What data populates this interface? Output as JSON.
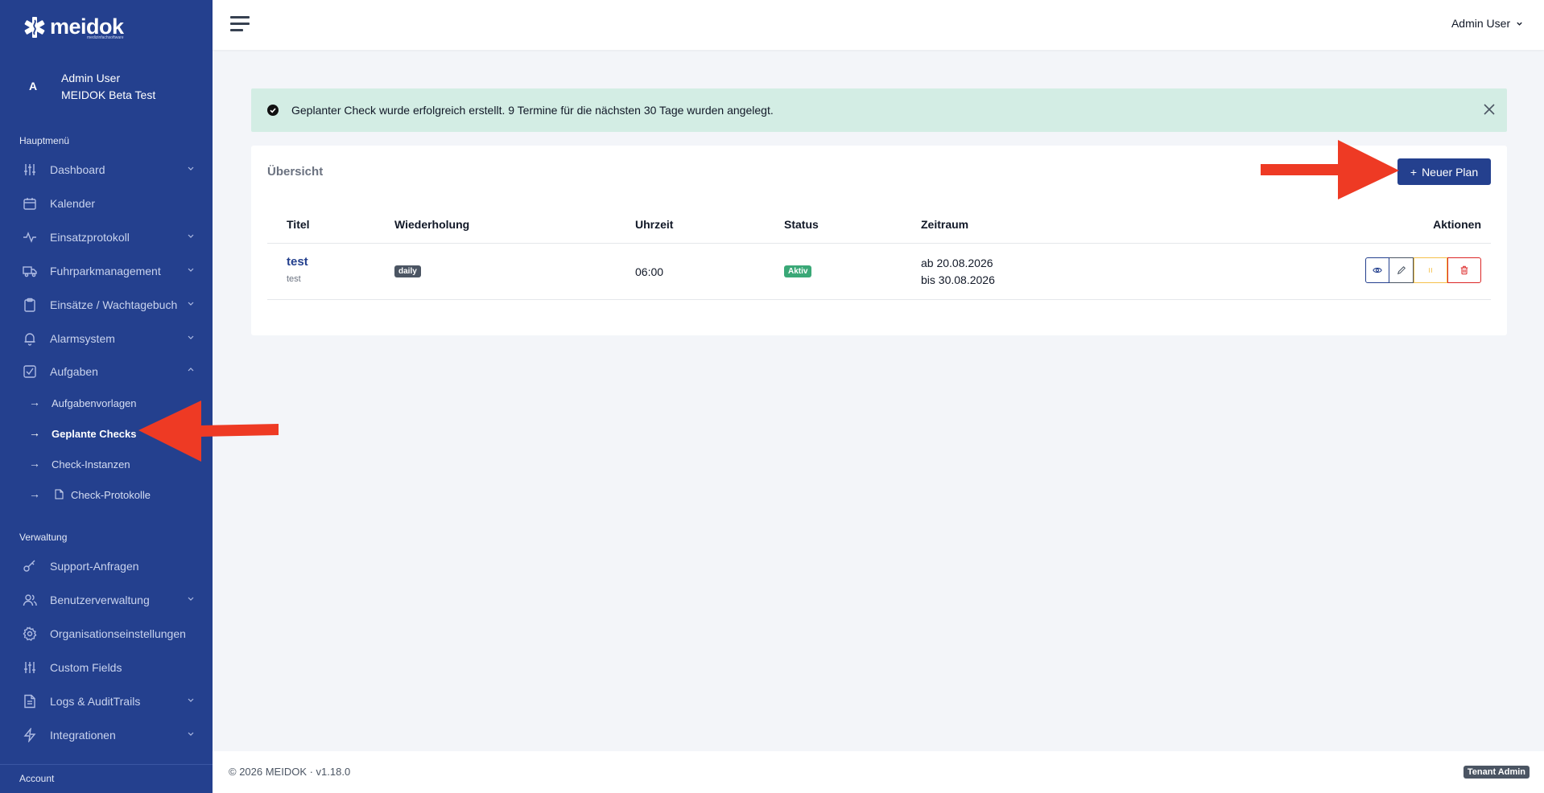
{
  "app": {
    "logo_text": "meidok",
    "logo_sub": "medizinfachsoftware"
  },
  "sidebar": {
    "user": {
      "initial": "A",
      "name": "Admin User",
      "org": "MEIDOK Beta Test"
    },
    "section_main": "Hauptmenü",
    "main_items": [
      {
        "label": "Dashboard",
        "icon": "sliders-icon"
      },
      {
        "label": "Kalender",
        "icon": "calendar-icon"
      },
      {
        "label": "Einsatzprotokoll",
        "icon": "activity-icon"
      },
      {
        "label": "Fuhrparkmanagement",
        "icon": "truck-icon"
      },
      {
        "label": "Einsätze / Wachtagebuch",
        "icon": "clipboard-icon"
      },
      {
        "label": "Alarmsystem",
        "icon": "bell-icon"
      },
      {
        "label": "Aufgaben",
        "icon": "checkbox-icon"
      }
    ],
    "sub_items": [
      {
        "label": "Aufgabenvorlagen"
      },
      {
        "label": "Geplante Checks"
      },
      {
        "label": "Check-Instanzen"
      },
      {
        "label": "Check-Protokolle"
      }
    ],
    "section_admin": "Verwaltung",
    "admin_items": [
      {
        "label": "Support-Anfragen",
        "icon": "key-icon"
      },
      {
        "label": "Benutzerverwaltung",
        "icon": "users-icon"
      },
      {
        "label": "Organisationseinstellungen",
        "icon": "gear-icon"
      },
      {
        "label": "Custom Fields",
        "icon": "sliders-icon"
      },
      {
        "label": "Logs & AuditTrails",
        "icon": "file-icon"
      },
      {
        "label": "Integrationen",
        "icon": "bolt-icon"
      }
    ],
    "footer_label": "Account"
  },
  "topbar": {
    "user": "Admin User"
  },
  "alert": {
    "message": "Geplanter Check wurde erfolgreich erstellt. 9 Termine für die nächsten 30 Tage wurden angelegt."
  },
  "card": {
    "title": "Übersicht",
    "new_button": "Neuer Plan",
    "columns": [
      "Titel",
      "Wiederholung",
      "Uhrzeit",
      "Status",
      "Zeitraum",
      "Aktionen"
    ],
    "rows": [
      {
        "title": "test",
        "subtitle": "test",
        "repeat": "daily",
        "time": "06:00",
        "status": "Aktiv",
        "from": "ab 20.08.2026",
        "to": "bis 30.08.2026"
      }
    ]
  },
  "footer": {
    "copyright": "© 2026 MEIDOK · v1.18.0",
    "role_badge": "Tenant Admin"
  },
  "colors": {
    "sidebar": "#24408e",
    "accent": "#24408e",
    "success_bg": "#d3ede4",
    "active_badge": "#3aa877",
    "annotation": "#ee3a24"
  }
}
